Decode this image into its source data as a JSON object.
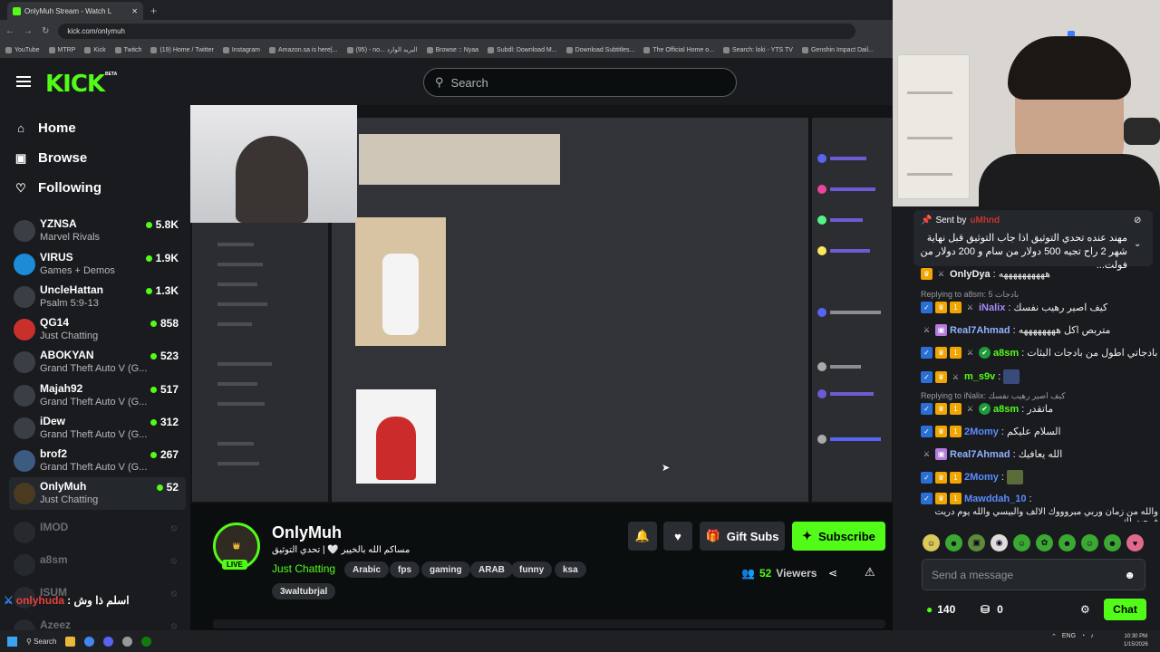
{
  "browser": {
    "tab_title": "OnlyMuh Stream - Watch L",
    "url": "kick.com/onlymuh",
    "bookmarks": [
      "YouTube",
      "MTRP",
      "Kick",
      "Twitch",
      "(19) Home / Twitter",
      "Instagram",
      "Amazon.sa is here|...",
      "(95) - no... البريد الوارد",
      "Browse :: Nyaa",
      "Subdl: Download M...",
      "Download Subtitles...",
      "The Official Home o...",
      "Search: loki - YTS TV",
      "Genshin Impact Dail..."
    ]
  },
  "header": {
    "logo": "KICK",
    "beta": "BETA",
    "search_placeholder": "Search"
  },
  "nav": {
    "home": "Home",
    "browse": "Browse",
    "following": "Following"
  },
  "channels": [
    {
      "name": "YZNSA",
      "game": "Marvel Rivals",
      "viewers": "5.8K"
    },
    {
      "name": "VIRUS",
      "game": "Games + Demos",
      "viewers": "1.9K"
    },
    {
      "name": "UncleHattan",
      "game": "Psalm 5:9-13",
      "viewers": "1.3K"
    },
    {
      "name": "QG14",
      "game": "Just Chatting",
      "viewers": "858"
    },
    {
      "name": "ABOKYAN",
      "game": "Grand Theft Auto V (G...",
      "viewers": "523"
    },
    {
      "name": "Majah92",
      "game": "Grand Theft Auto V (G...",
      "viewers": "517"
    },
    {
      "name": "iDew",
      "game": "Grand Theft Auto V (G...",
      "viewers": "312"
    },
    {
      "name": "brof2",
      "game": "Grand Theft Auto V (G...",
      "viewers": "267"
    },
    {
      "name": "OnlyMuh",
      "game": "Just Chatting",
      "viewers": "52"
    }
  ],
  "offline_channels": [
    "IMOD",
    "a8sm",
    "ISUM",
    "Azeez"
  ],
  "stream": {
    "channel": "OnlyMuh",
    "live_label": "LIVE",
    "title": "مساكم الله بالخيير 🤍 | تحدي التوثيق",
    "category": "Just Chatting",
    "tags": [
      "Arabic",
      "fps",
      "gaming",
      "ARAB",
      "funny",
      "ksa",
      "3waltubrjal"
    ],
    "viewers": "52",
    "viewers_label": "Viewers",
    "gift_label": "Gift Subs",
    "subscribe_label": "Subscribe"
  },
  "pinned": {
    "sent_by": "Sent by",
    "user": "uMhnd",
    "text": "مهند عنده تحدي التوثيق اذا جاب التوثيق قبل نهاية شهر 2 راح تجيه 500 دولار من سام و 200 دولار من فولت..."
  },
  "chat": [
    {
      "type": "msg",
      "user": "OnlyDya",
      "color": "#f0f0f0",
      "text": "ههههههههههه"
    },
    {
      "type": "reply",
      "text": "Replying to a8sm: 5 بادجات"
    },
    {
      "type": "msg",
      "user": "iNalix",
      "color": "#a78bfa",
      "text": "كيف اصير رهيب نفسك"
    },
    {
      "type": "msg",
      "user": "Real7Ahmad",
      "color": "#8fb2ff",
      "text": "متربص اكل ههههههههه"
    },
    {
      "type": "msg",
      "user": "a8sm",
      "color": "#53fc18",
      "text": "بادجاتي اطول من بادجات البثات"
    },
    {
      "type": "msg",
      "user": "m_s9v",
      "color": "#53fc18",
      "text": ""
    },
    {
      "type": "reply",
      "text": "Replying to iNalix: كيف اصير رهيب نفسك"
    },
    {
      "type": "msg",
      "user": "a8sm",
      "color": "#53fc18",
      "text": "ماتقدر"
    },
    {
      "type": "msg",
      "user": "2Momy",
      "color": "#5b8cff",
      "text": "السلام عليكم"
    },
    {
      "type": "msg",
      "user": "Real7Ahmad",
      "color": "#8fb2ff",
      "text": "الله يعافيك"
    },
    {
      "type": "msg",
      "user": "2Momy",
      "color": "#5b8cff",
      "text": ""
    },
    {
      "type": "msg",
      "user": "Mawddah_10",
      "color": "#5b8cff",
      "text": "والله من زمان وربي مبروووك الالف والبيسي والله يوم دريت فرحت لك"
    }
  ],
  "chat_input": {
    "placeholder": "Send a message",
    "points": "140",
    "chests": "0",
    "chat_button": "Chat"
  },
  "overlay": {
    "user": "onlyhuda",
    "text": ": اسلم ذا وش"
  },
  "taskbar": {
    "search": "Search",
    "lang": "ENG",
    "time": "10:30 PM",
    "date": "1/15/2026"
  }
}
